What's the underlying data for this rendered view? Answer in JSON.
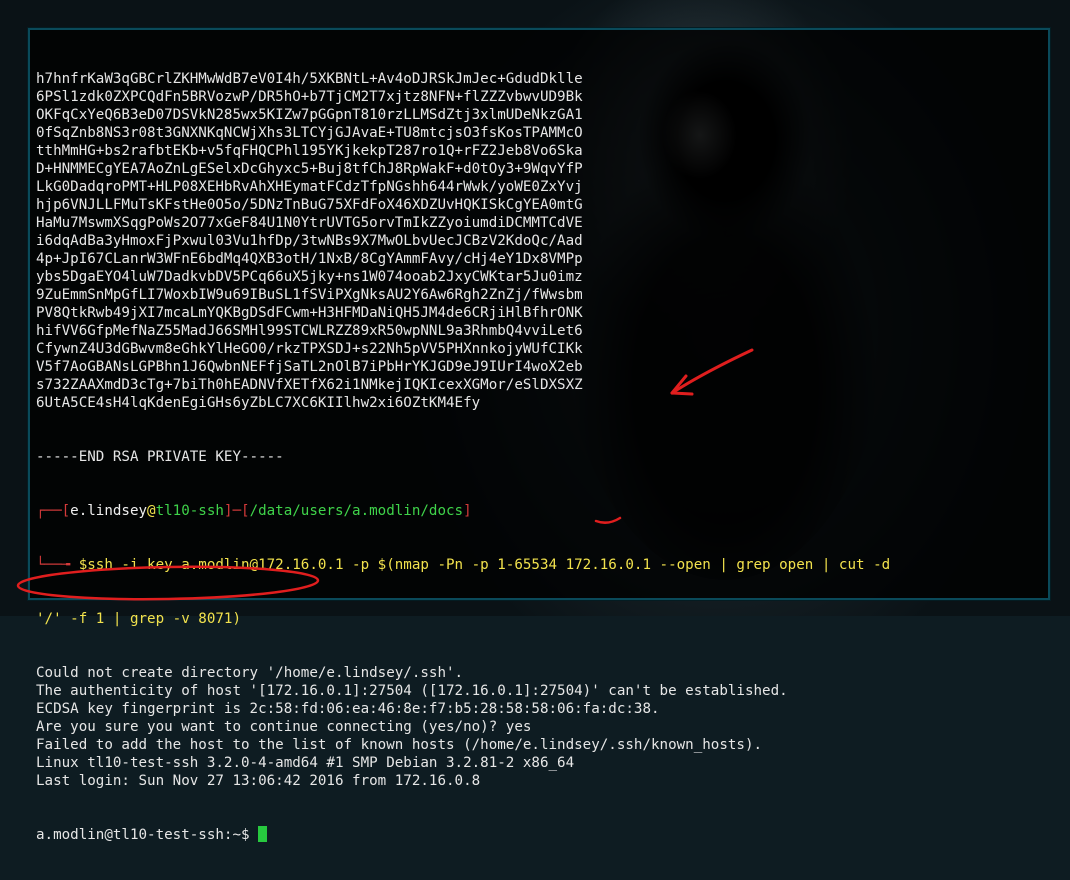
{
  "terminal": {
    "key_lines": [
      "h7hnfrKaW3qGBCrlZKHMwWdB7eV0I4h/5XKBNtL+Av4oDJRSkJmJec+GdudDklle",
      "6PSl1zdk0ZXPCQdFn5BRVozwP/DR5hO+b7TjCM2T7xjtz8NFN+flZZZvbwvUD9Bk",
      "OKFqCxYeQ6B3eD07DSVkN285wx5KIZw7pGGpnT810rzLLMSdZtj3xlmUDeNkzGA1",
      "0fSqZnb8NS3r08t3GNXNKqNCWjXhs3LTCYjGJAvaE+TU8mtcjsO3fsKosTPAMMcO",
      "tthMmHG+bs2rafbtEKb+v5fqFHQCPhl195YKjkekpT287ro1Q+rFZ2Jeb8Vo6Ska",
      "D+HNMMECgYEA7AoZnLgESelxDcGhyxc5+Buj8tfChJ8RpWakF+d0tOy3+9WqvYfP",
      "LkG0DadqroPMT+HLP08XEHbRvAhXHEymatFCdzTfpNGshh644rWwk/yoWE0ZxYvj",
      "hjp6VNJLLFMuTsKFstHe0O5o/5DNzTnBuG75XFdFoX46XDZUvHQKISkCgYEA0mtG",
      "HaMu7MswmXSqgPoWs2O77xGeF84U1N0YtrUVTG5orvTmIkZZyoiumdiDCMMTCdVE",
      "i6dqAdBa3yHmoxFjPxwul03Vu1hfDp/3twNBs9X7MwOLbvUecJCBzV2KdoQc/Aad",
      "4p+JpI67CLanrW3WFnE6bdMq4QXB3otH/1NxB/8CgYAmmFAvy/cHj4eY1Dx8VMPp",
      "ybs5DgaEYO4luW7DadkvbDV5PCq66uX5jky+ns1W074ooab2JxyCWKtar5Ju0imz",
      "9ZuEmmSnMpGfLI7WoxbIW9u69IBuSL1fSViPXgNksAU2Y6Aw6Rgh2ZnZj/fWwsbm",
      "PV8QtkRwb49jXI7mcaLmYQKBgDSdFCwm+H3HFMDaNiQH5JM4de6CRjiHlBfhrONK",
      "hifVV6GfpMefNaZ55MadJ66SMHl99STCWLRZZ89xR50wpNNL9a3RhmbQ4vviLet6",
      "CfywnZ4U3dGBwvm8eGhkYlHeGO0/rkzTPXSDJ+s22Nh5pVV5PHXnnkojyWUfCIKk",
      "V5f7AoGBANsLGPBhn1J6QwbnNEFfjSaTL2nOlB7iPbHrYKJGD9eJ9IUrI4woX2eb",
      "s732ZAAXmdD3cTg+7biTh0hEADNVfXETfX62i1NMkejIQKIcexXGMor/eSlDXSXZ",
      "6UtA5CE4sH4lqKdenEgiGHs6yZbLC7XC6KIIlhw2xi6OZtKM4Efy"
    ],
    "end_marker": "-----END RSA PRIVATE KEY-----",
    "prompt": {
      "open_bracket": "┌──[",
      "user": "e.lindsey",
      "at": "@",
      "host": "tl10-ssh",
      "sep": "]─[",
      "path": "/data/users/a.modlin/docs",
      "close": "]",
      "corner": "└──╼ ",
      "dollar": "$",
      "command_1": "ssh -i key a.modlin@172.16.0.1 -p $(nmap -Pn -p 1-65534 172.16.0.1 --open | grep open | cut -d",
      "command_2": "'/' -f 1 | grep -v 8071)"
    },
    "output_lines": [
      "Could not create directory '/home/e.lindsey/.ssh'.",
      "The authenticity of host '[172.16.0.1]:27504 ([172.16.0.1]:27504)' can't be established.",
      "ECDSA key fingerprint is 2c:58:fd:06:ea:46:8e:f7:b5:28:58:58:06:fa:dc:38.",
      "Are you sure you want to continue connecting (yes/no)? yes",
      "Failed to add the host to the list of known hosts (/home/e.lindsey/.ssh/known_hosts).",
      "Linux tl10-test-ssh 3.2.0-4-amd64 #1 SMP Debian 3.2.81-2 x86_64",
      "Last login: Sun Nov 27 13:06:42 2016 from 172.16.0.8"
    ],
    "final_prompt": "a.modlin@tl10-test-ssh:~$ "
  },
  "colors": {
    "prompt_bracket": "#d43a3a",
    "prompt_user": "#f0f0f0",
    "prompt_host": "#3fd34a",
    "prompt_path": "#4a6cd8",
    "command": "#f2e24d",
    "cursor": "#27c93f",
    "annotation": "#e01e1e"
  }
}
